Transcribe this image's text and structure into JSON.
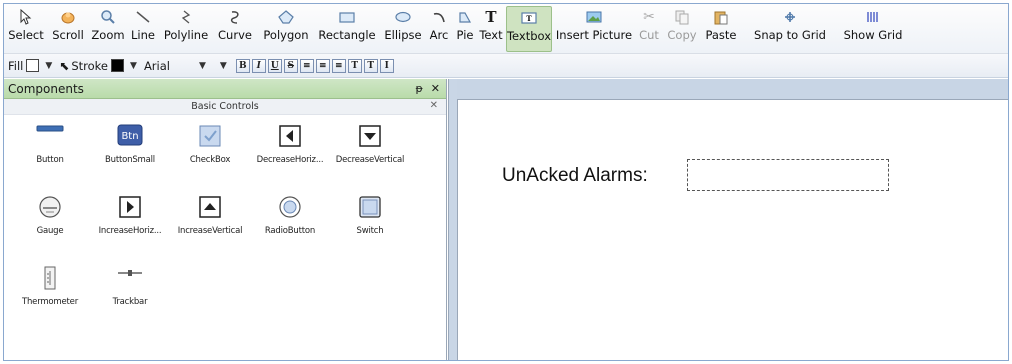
{
  "toolbar": {
    "tools": [
      {
        "id": "select",
        "label": "Select",
        "icon": "pointer-icon"
      },
      {
        "id": "scroll",
        "label": "Scroll",
        "icon": "hand-icon"
      },
      {
        "id": "zoom",
        "label": "Zoom",
        "icon": "magnifier-icon"
      },
      {
        "id": "line",
        "label": "Line",
        "icon": "line-icon"
      },
      {
        "id": "polyline",
        "label": "Polyline",
        "icon": "polyline-icon"
      },
      {
        "id": "curve",
        "label": "Curve",
        "icon": "curve-icon"
      },
      {
        "id": "polygon",
        "label": "Polygon",
        "icon": "polygon-icon"
      },
      {
        "id": "rectangle",
        "label": "Rectangle",
        "icon": "rectangle-icon"
      },
      {
        "id": "ellipse",
        "label": "Ellipse",
        "icon": "ellipse-icon"
      },
      {
        "id": "arc",
        "label": "Arc",
        "icon": "arc-icon"
      },
      {
        "id": "pie",
        "label": "Pie",
        "icon": "pie-icon"
      },
      {
        "id": "text",
        "label": "Text",
        "icon": "text-icon"
      },
      {
        "id": "textbox",
        "label": "Textbox",
        "icon": "textbox-icon",
        "active": true
      },
      {
        "id": "insert_picture",
        "label": "Insert Picture",
        "icon": "picture-icon"
      },
      {
        "id": "cut",
        "label": "Cut",
        "icon": "scissors-icon",
        "disabled": true
      },
      {
        "id": "copy",
        "label": "Copy",
        "icon": "copy-icon",
        "disabled": true
      },
      {
        "id": "paste",
        "label": "Paste",
        "icon": "paste-icon"
      },
      {
        "id": "snap_to_grid",
        "label": "Snap to Grid",
        "icon": "snap-grid-icon"
      },
      {
        "id": "show_grid",
        "label": "Show Grid",
        "icon": "grid-icon"
      }
    ]
  },
  "format_bar": {
    "fill_label": "Fill",
    "stroke_label": "Stroke",
    "font_name": "Arial",
    "fill_color": "#ffffff",
    "stroke_color": "#000000",
    "buttons": [
      {
        "id": "bold",
        "glyph": "B",
        "icon": "bold-icon"
      },
      {
        "id": "italic",
        "glyph": "I",
        "icon": "italic-icon"
      },
      {
        "id": "underline",
        "glyph": "U",
        "icon": "underline-icon"
      },
      {
        "id": "strike",
        "glyph": "S",
        "icon": "strikethrough-icon"
      },
      {
        "id": "align_left",
        "glyph": "≡",
        "icon": "align-left-icon"
      },
      {
        "id": "align_center",
        "glyph": "≡",
        "icon": "align-center-icon"
      },
      {
        "id": "align_right",
        "glyph": "≡",
        "icon": "align-right-icon"
      },
      {
        "id": "valign_top",
        "glyph": "T",
        "icon": "valign-top-icon"
      },
      {
        "id": "valign_middle",
        "glyph": "T",
        "icon": "valign-middle-icon"
      },
      {
        "id": "valign_bottom",
        "glyph": "I",
        "icon": "valign-bottom-icon"
      }
    ]
  },
  "components_panel": {
    "title": "Components",
    "pin_glyph": "ᵽ",
    "close_glyph": "✕",
    "group": {
      "title": "Basic Controls",
      "close_glyph": "✕",
      "items": [
        {
          "label": "Button",
          "icon": "button-icon"
        },
        {
          "label": "ButtonSmall",
          "icon": "button-small-icon",
          "icon_text": "Btn"
        },
        {
          "label": "CheckBox",
          "icon": "checkbox-icon"
        },
        {
          "label": "DecreaseHoriz...",
          "icon": "decrease-horizontal-icon"
        },
        {
          "label": "DecreaseVertical",
          "icon": "decrease-vertical-icon"
        },
        {
          "label": "Gauge",
          "icon": "gauge-icon"
        },
        {
          "label": "IncreaseHoriz...",
          "icon": "increase-horizontal-icon"
        },
        {
          "label": "IncreaseVertical",
          "icon": "increase-vertical-icon"
        },
        {
          "label": "RadioButton",
          "icon": "radio-button-icon"
        },
        {
          "label": "Switch",
          "icon": "switch-icon"
        },
        {
          "label": "Thermometer",
          "icon": "thermometer-icon"
        },
        {
          "label": "Trackbar",
          "icon": "trackbar-icon"
        }
      ]
    }
  },
  "canvas": {
    "label_text": "UnAcked Alarms:",
    "textbox_value": ""
  },
  "colors": {
    "accent_green": "#b9dbaa",
    "panel_blue": "#c8d5e5",
    "active_tool": "#cfe3c1"
  }
}
